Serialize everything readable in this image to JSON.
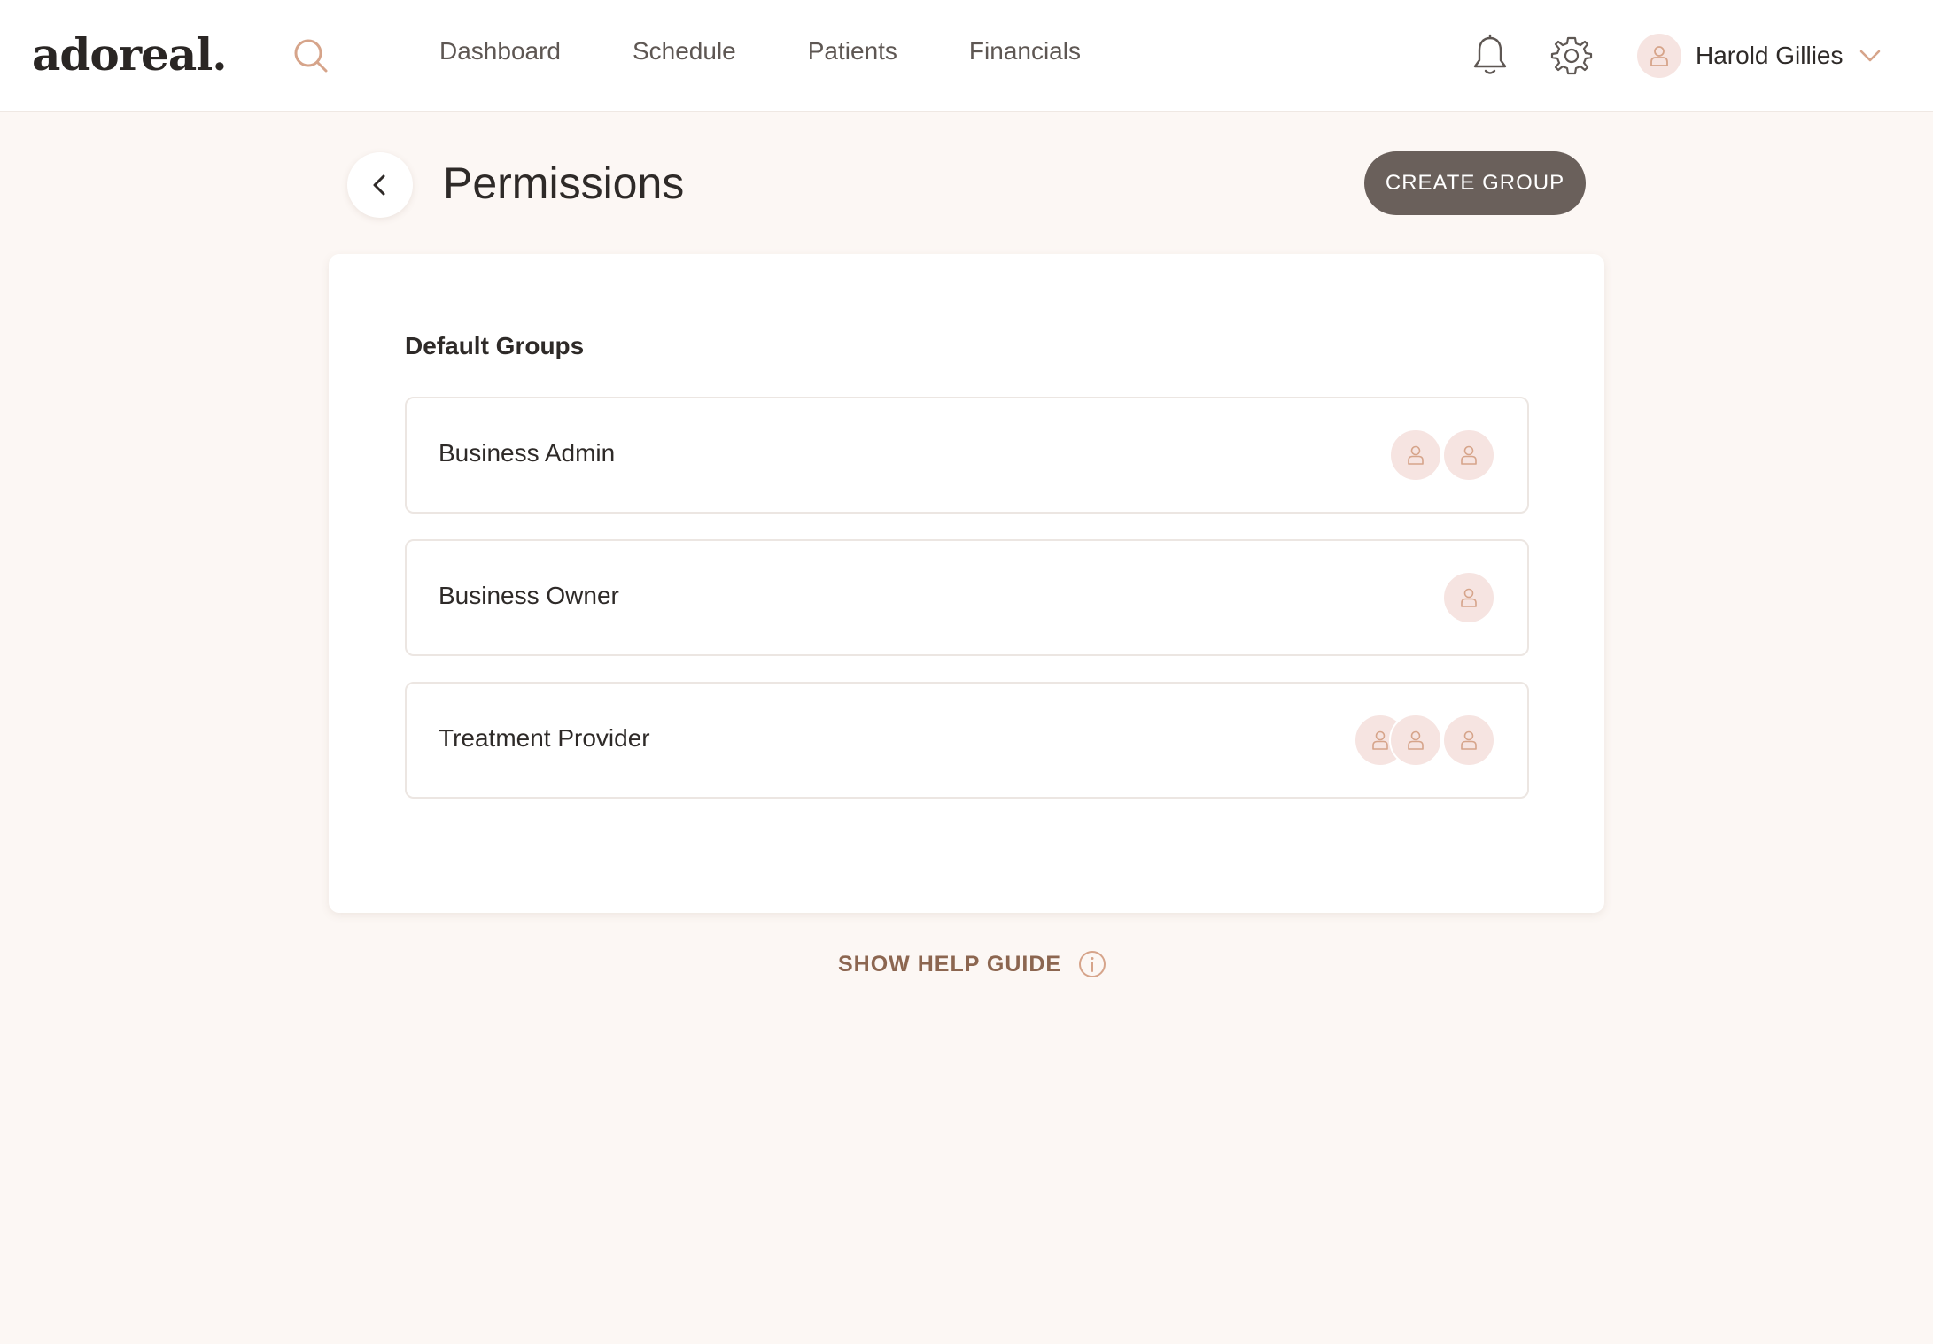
{
  "app": {
    "logo_text": "adoreal."
  },
  "nav": {
    "items": [
      {
        "label": "Dashboard"
      },
      {
        "label": "Schedule"
      },
      {
        "label": "Patients"
      },
      {
        "label": "Financials"
      }
    ]
  },
  "header_icons": {
    "search": "search-icon",
    "notifications": "bell-icon",
    "settings": "gear-icon"
  },
  "user": {
    "name": "Harold Gillies",
    "avatar_icon": "user-icon",
    "menu_icon": "chevron-down-icon"
  },
  "page": {
    "title": "Permissions",
    "back_icon": "chevron-left-icon",
    "create_button_label": "CREATE GROUP"
  },
  "section": {
    "title": "Default Groups"
  },
  "groups": [
    {
      "name": "Business Admin",
      "member_count": 2
    },
    {
      "name": "Business Owner",
      "member_count": 1
    },
    {
      "name": "Treatment Provider",
      "member_count": 3
    }
  ],
  "help": {
    "label": "SHOW HELP GUIDE",
    "icon": "info-icon"
  },
  "colors": {
    "page_background": "#fcf7f4",
    "primary_button": "#6a605b",
    "avatar_background": "#f6e4e1",
    "icon_accent": "#d6a48a",
    "help_text": "#8c6650"
  }
}
